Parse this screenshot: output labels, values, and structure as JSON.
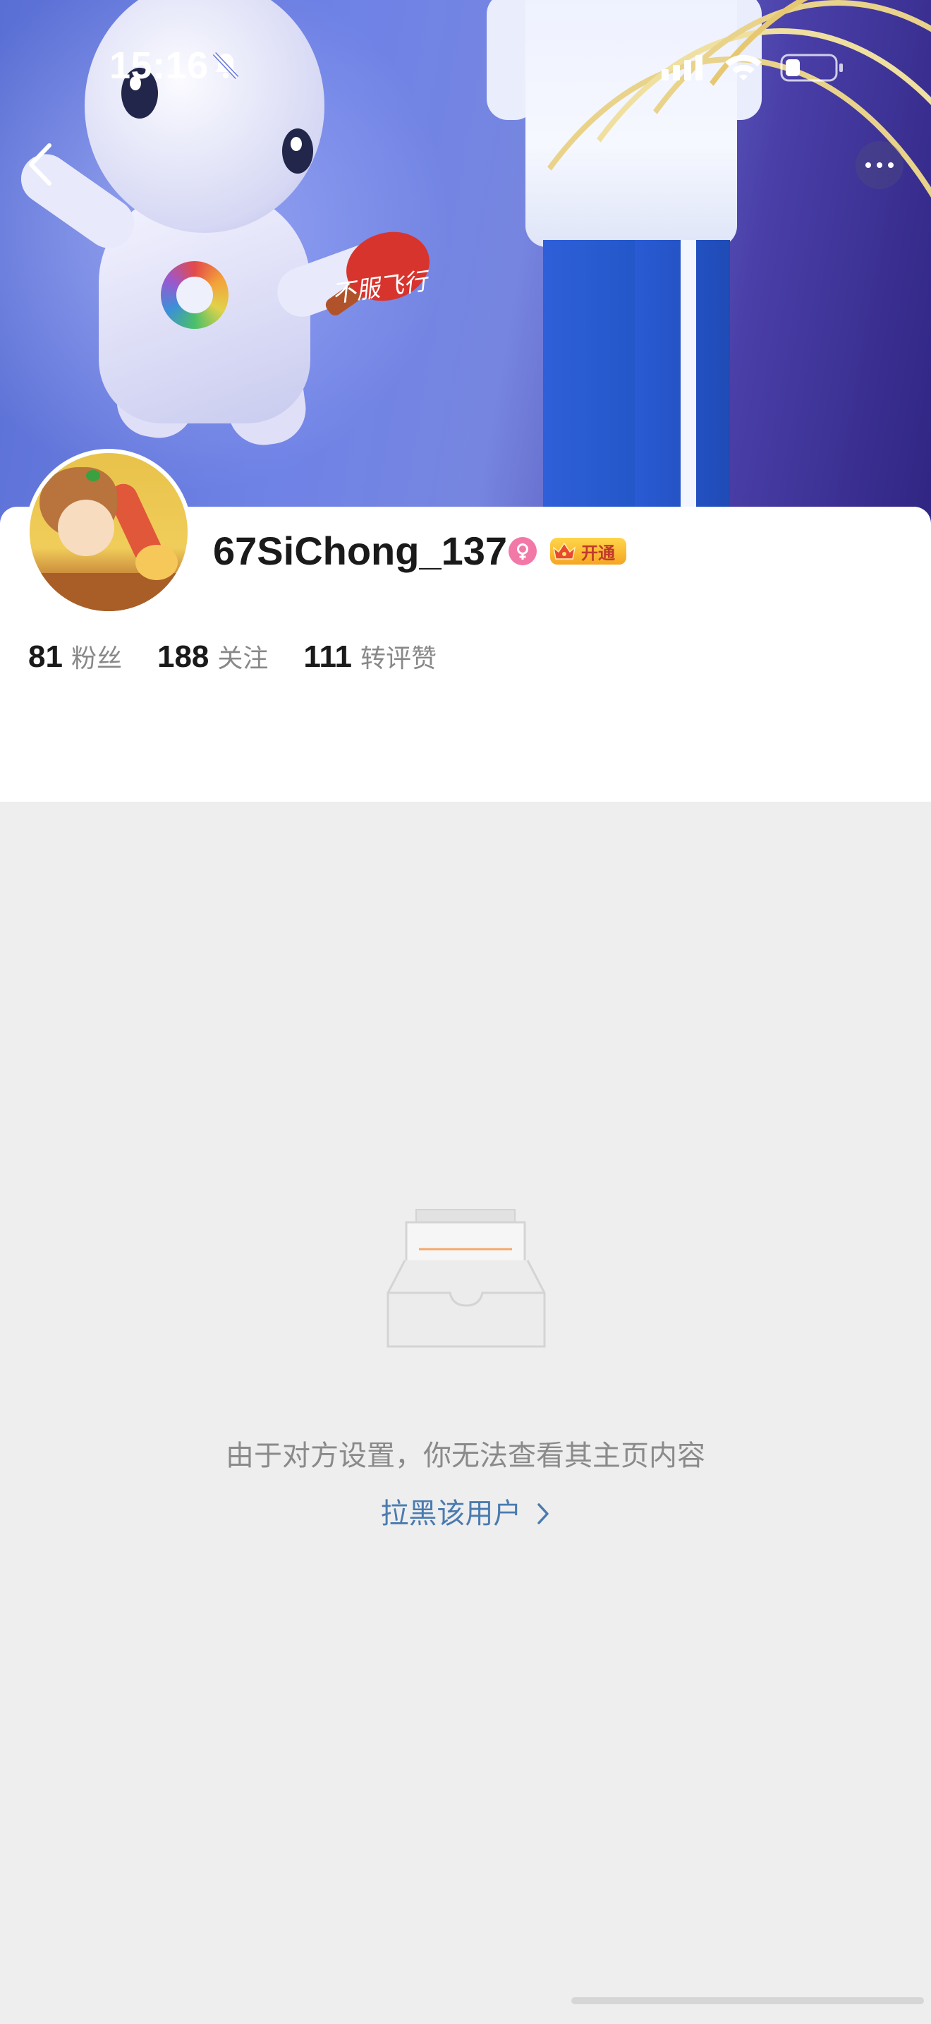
{
  "status_bar": {
    "time": "15:16"
  },
  "profile": {
    "username": "67SiChong_137",
    "vip_label": "开通",
    "stats": [
      {
        "value": "81",
        "label": "粉丝"
      },
      {
        "value": "188",
        "label": "关注"
      },
      {
        "value": "111",
        "label": "转评赞"
      }
    ]
  },
  "banner": {
    "handwriting": "不服飞行"
  },
  "empty_state": {
    "message": "由于对方设置，你无法查看其主页内容",
    "block_link": "拉黑该用户"
  },
  "icons": {
    "back": "chevron-left-icon",
    "more": "more-horizontal-icon",
    "gender": "female-icon",
    "vip": "crown-icon",
    "empty": "empty-inbox-icon"
  },
  "colors": {
    "link": "#4a7bb0",
    "vip_badge": "#f5a623",
    "gender_badge": "#f278a8",
    "background": "#eeeeee"
  }
}
